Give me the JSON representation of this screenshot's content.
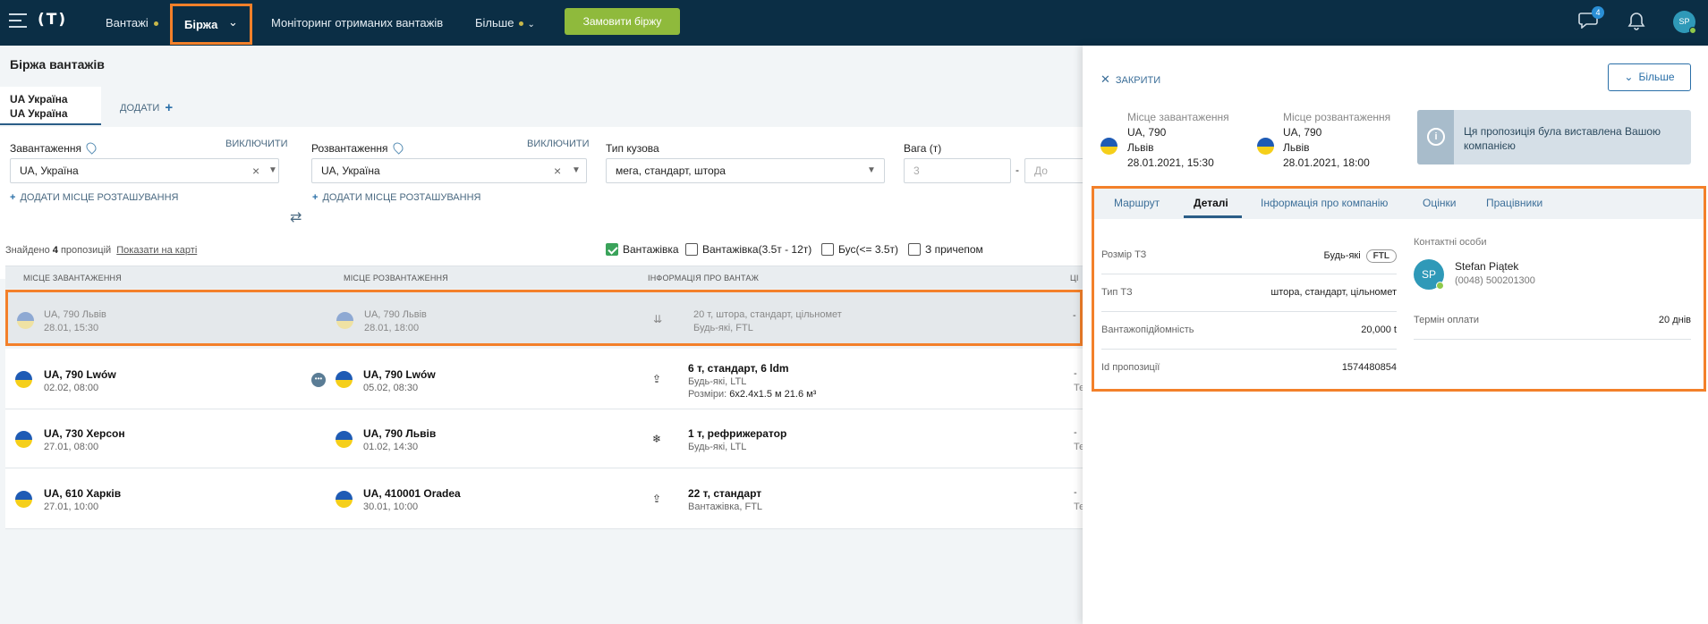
{
  "nav": {
    "logo": "(Т)",
    "items": [
      "Вантажі",
      "Біржа",
      "Моніторинг отриманих вантажів",
      "Більше"
    ],
    "order_button": "Замовити біржу",
    "chat_badge": "4",
    "avatar": "SP"
  },
  "page": {
    "title": "Біржа вантажів",
    "country_tab_line1": "UA Україна",
    "country_tab_line2": "UA Україна",
    "add_tab": "ДОДАТИ"
  },
  "filters": {
    "loading_label": "Завантаження",
    "unloading_label": "Розвантаження",
    "exclude_link": "ВИКЛЮЧИТИ",
    "loading_value": "UA,  Україна",
    "unloading_value": "UA,  Україна",
    "add_location": "ДОДАТИ МІСЦЕ РОЗТАШУВАННЯ",
    "body_type_label": "Тип кузова",
    "body_type_value": "мега, стандарт, штора",
    "weight_label": "Вага (т)",
    "weight_from_placeholder": "3",
    "weight_to_placeholder": "До",
    "checkboxes": [
      {
        "label": "Вантажівка",
        "checked": true
      },
      {
        "label": "Вантажівка(3.5т - 12т)",
        "checked": false
      },
      {
        "label": "Бус(<= 3.5т)",
        "checked": false
      },
      {
        "label": "З причепом",
        "checked": false
      }
    ]
  },
  "results": {
    "found_prefix": "Знайдено",
    "found_count": "4",
    "found_suffix": "пропозицій",
    "show_on_map": "Показати на карті",
    "headers": [
      "МІСЦЕ ЗАВАНТАЖЕННЯ",
      "МІСЦЕ РОЗВАНТАЖЕННЯ",
      "ІНФОРМАЦІЯ ПРО ВАНТАЖ",
      "ЦІ"
    ],
    "rows": [
      {
        "from": "UA, 790 Львів",
        "from_date": "28.01, 15:30",
        "to": "UA, 790 Львів",
        "to_date": "28.01, 18:00",
        "cargo": "20 т, штора, стандарт, цільномет",
        "cargo_sub": "Будь-які, FTL",
        "cargo_sub2": "",
        "icon": "⇊",
        "price": "-",
        "price_sub": "Те"
      },
      {
        "from": "UA, 790 Lwów",
        "from_date": "02.02, 08:00",
        "to": "UA, 790 Lwów",
        "to_date": "05.02, 08:30",
        "cargo": "6 т, стандарт, 6 ldm",
        "cargo_sub": "Будь-які, LTL",
        "cargo_sub2_label": "Розміри:",
        "cargo_sub2": "6x2.4x1.5 м 21.6 м³",
        "icon": "⇪",
        "price": "-",
        "price_sub": "Те"
      },
      {
        "from": "UA, 730 Херсон",
        "from_date": "27.01, 08:00",
        "to": "UA, 790 Львів",
        "to_date": "01.02, 14:30",
        "cargo": "1 т, рефрижератор",
        "cargo_sub": "Будь-які, LTL",
        "cargo_sub2": "",
        "icon": "❄",
        "price": "-",
        "price_sub": "Те"
      },
      {
        "from": "UA, 610 Харків",
        "from_date": "27.01, 10:00",
        "to": "UA, 410001 Oradea",
        "to_date": "30.01, 10:00",
        "cargo": "22 т, стандарт",
        "cargo_sub": "Вантажівка, FTL",
        "cargo_sub2": "",
        "icon": "⇪",
        "price": "-",
        "price_sub": "Те"
      }
    ]
  },
  "panel": {
    "close": "ЗАКРИТИ",
    "more": "Більше",
    "loading_h": "Місце завантаження",
    "loading_l1": "UA, 790",
    "loading_l2": "Львів",
    "loading_l3": "28.01.2021, 15:30",
    "unloading_h": "Місце розвантаження",
    "unloading_l1": "UA, 790",
    "unloading_l2": "Львів",
    "unloading_l3": "28.01.2021, 18:00",
    "info_text": "Ця пропозиція була виставлена Вашою компанією",
    "tabs": [
      "Маршрут",
      "Деталі",
      "Інформація про компанію",
      "Оцінки",
      "Працівники"
    ],
    "details": [
      {
        "k": "Розмір ТЗ",
        "v": "Будь-які",
        "tag": "FTL"
      },
      {
        "k": "Тип ТЗ",
        "v": "штора, стандарт, цільномет"
      },
      {
        "k": "Вантажопідйомність",
        "v": "20,000 t"
      },
      {
        "k": "Id пропозиції",
        "v": "1574480854"
      }
    ],
    "contact_h": "Контактні особи",
    "contact_avatar": "SP",
    "contact_name": "Stefan Piątek",
    "contact_phone": "(0048) 500201300",
    "payment_k": "Термін оплати",
    "payment_v": "20 днів"
  }
}
